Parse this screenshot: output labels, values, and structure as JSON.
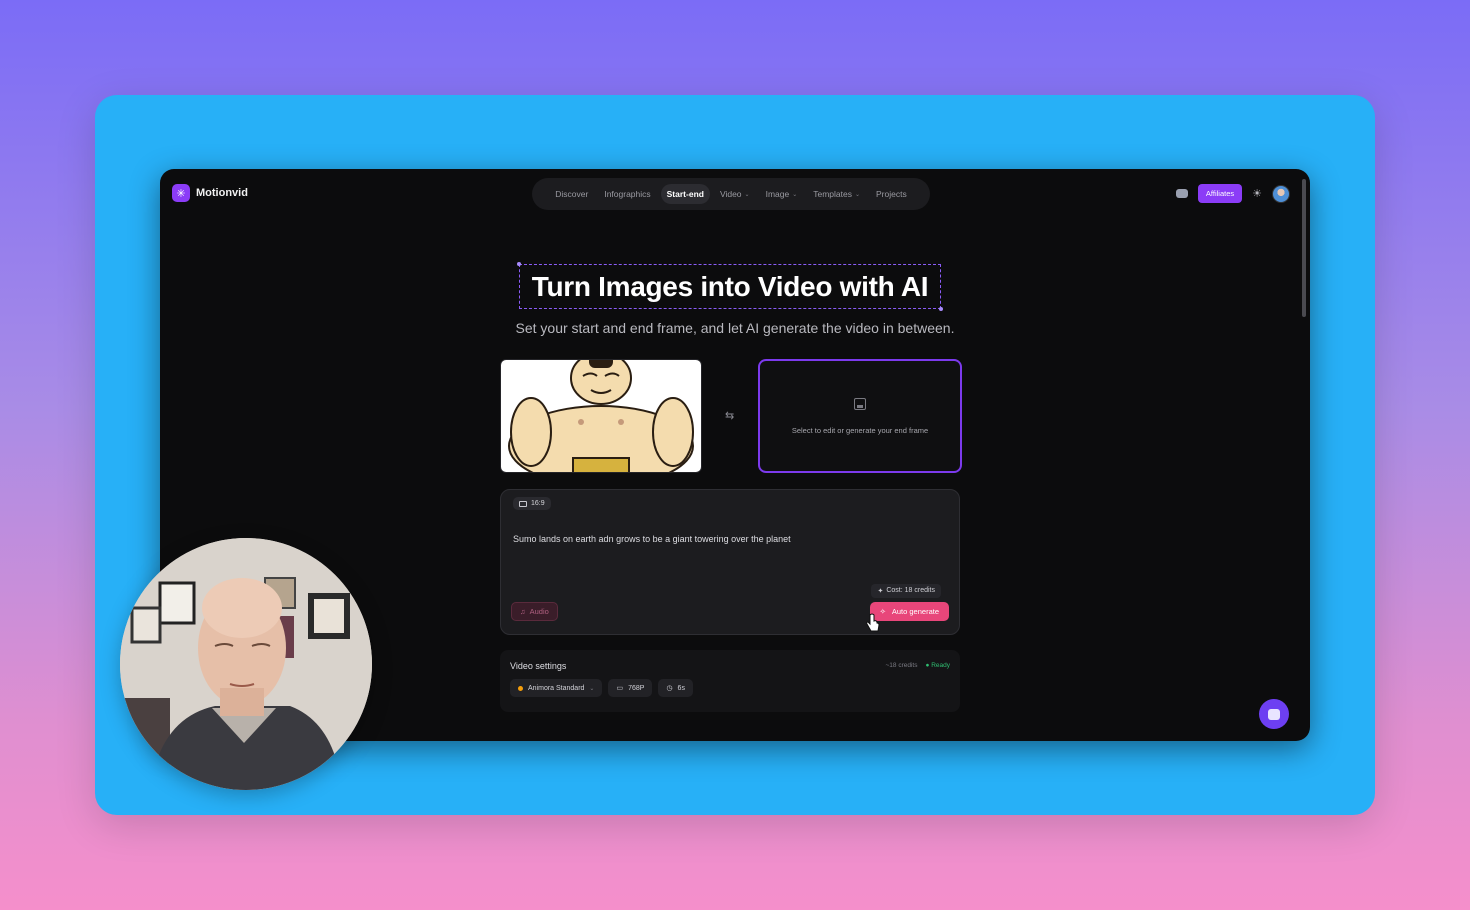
{
  "brand": {
    "name": "Motionvid"
  },
  "nav": {
    "items": [
      {
        "label": "Discover",
        "active": false,
        "dropdown": false
      },
      {
        "label": "Infographics",
        "active": false,
        "dropdown": false
      },
      {
        "label": "Start-end",
        "active": true,
        "dropdown": false
      },
      {
        "label": "Video",
        "active": false,
        "dropdown": true
      },
      {
        "label": "Image",
        "active": false,
        "dropdown": true
      },
      {
        "label": "Templates",
        "active": false,
        "dropdown": true
      },
      {
        "label": "Projects",
        "active": false,
        "dropdown": false
      }
    ],
    "affiliates_label": "Affiliates"
  },
  "hero": {
    "title": "Turn Images into Video with AI",
    "subtitle": "Set your start and end frame, and let AI generate the video in between."
  },
  "frames": {
    "end_frame_label": "Select to edit or generate your end frame"
  },
  "prompt": {
    "aspect_ratio": "16:9",
    "text": "Sumo lands on earth adn grows to be a giant towering over the planet",
    "cost_label": "Cost: 18 credits",
    "audio_label": "Audio",
    "generate_label": "Auto generate"
  },
  "video_settings": {
    "title": "Video settings",
    "credits": "~18 credits",
    "status": "Ready",
    "model": "Animora Standard",
    "resolution": "768P",
    "duration": "6s"
  },
  "colors": {
    "accent": "#8b3cf7",
    "generate": "#e8467a",
    "ready": "#2fbf71",
    "frame_bg": "#27b0f7"
  }
}
